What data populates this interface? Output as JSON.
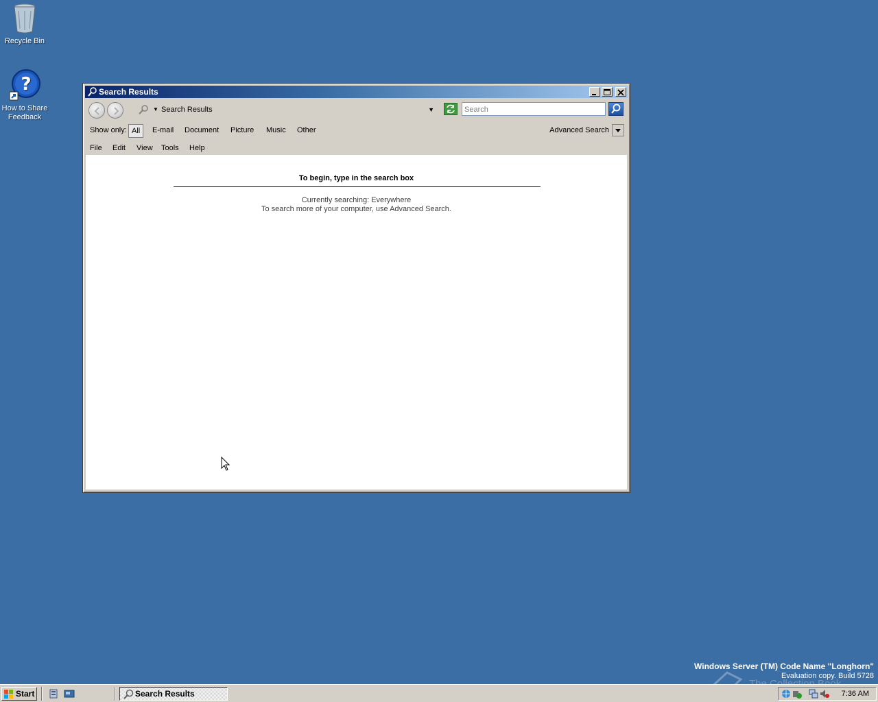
{
  "desktop": {
    "icons": [
      {
        "label": "Recycle Bin",
        "icon": "recycle-bin-icon"
      },
      {
        "label": "How to Share Feedback",
        "label_line1": "How to Share",
        "label_line2": "Feedback",
        "icon": "help-icon"
      }
    ],
    "background_color": "#3a6ea5",
    "watermark": {
      "title": "Windows Server (TM) Code Name \"Longhorn\"",
      "subtitle": "Evaluation copy. Build 5728"
    },
    "overlay_watermark": "The Collection Book"
  },
  "window": {
    "title": "Search Results",
    "address": "Search Results",
    "search_placeholder": "Search",
    "filter": {
      "label": "Show only:",
      "options": [
        "All",
        "E-mail",
        "Document",
        "Picture",
        "Music",
        "Other"
      ],
      "selected": "All",
      "advanced": "Advanced Search"
    },
    "menu": [
      "File",
      "Edit",
      "View",
      "Tools",
      "Help"
    ],
    "content": {
      "heading": "To begin, type in the search box",
      "line1": "Currently searching: Everywhere",
      "line2": "To search more of your computer, use Advanced Search."
    }
  },
  "taskbar": {
    "start_label": "Start",
    "task_label": "Search Results",
    "clock": "7:36 AM"
  }
}
